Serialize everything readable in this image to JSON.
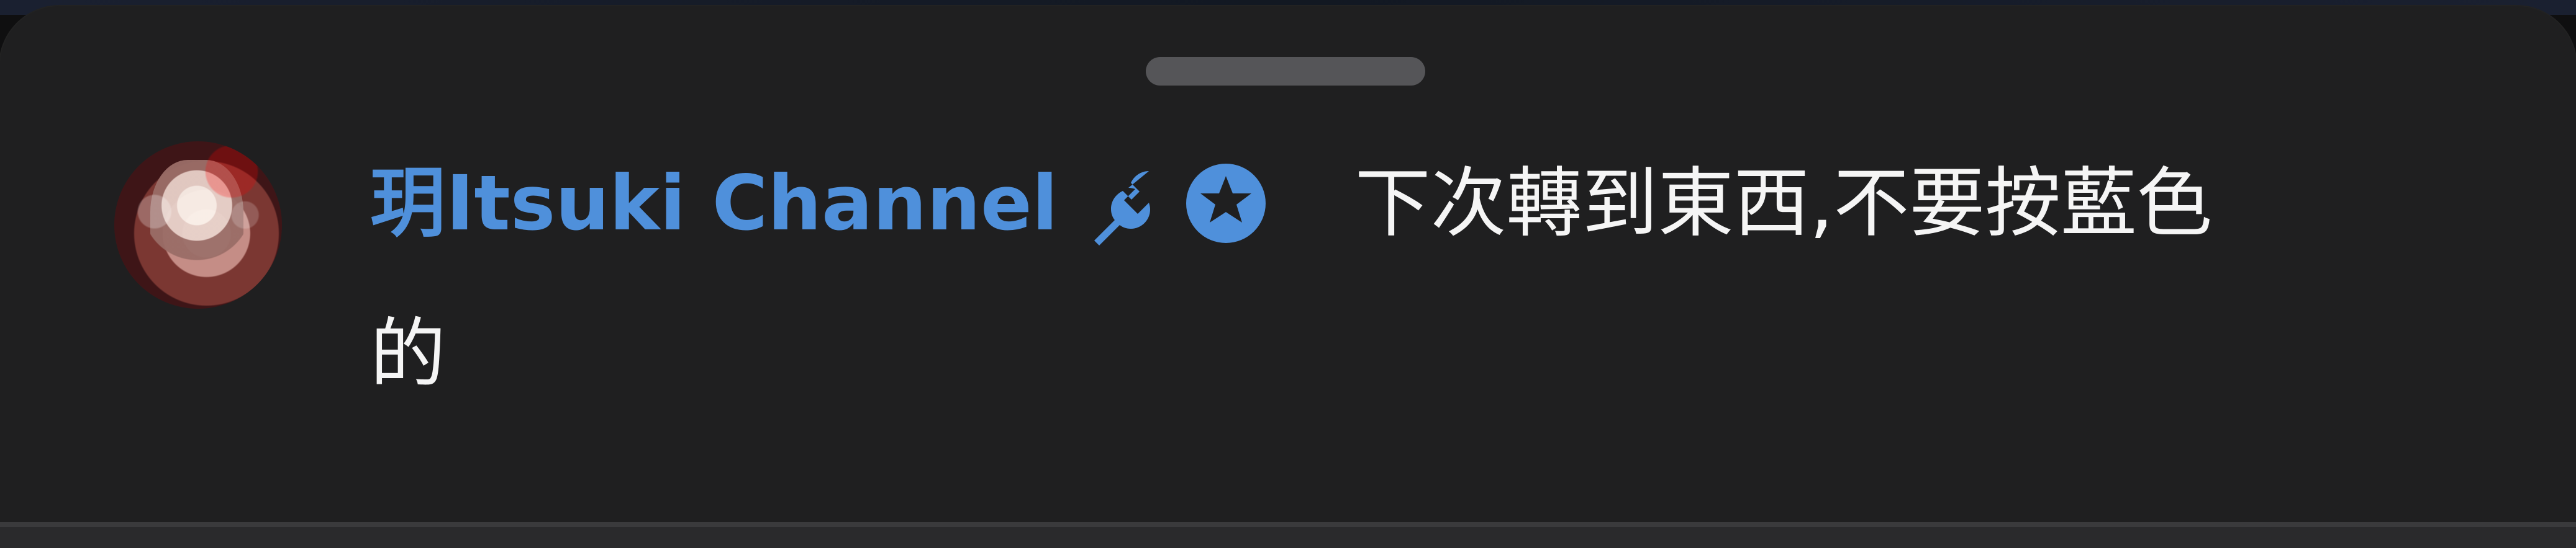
{
  "comment": {
    "author_name": "玥Itsuki Channel",
    "message_line_1": "下次轉到東西,不要按藍色",
    "message_line_2": "的"
  },
  "icons": {
    "wrench": "wrench-icon",
    "star_badge": "star-badge-icon"
  },
  "colors": {
    "background": "#1f1f20",
    "author": "#4f90db",
    "text": "#f5f5f5",
    "handle": "#555558",
    "badge": "#4f90db"
  }
}
